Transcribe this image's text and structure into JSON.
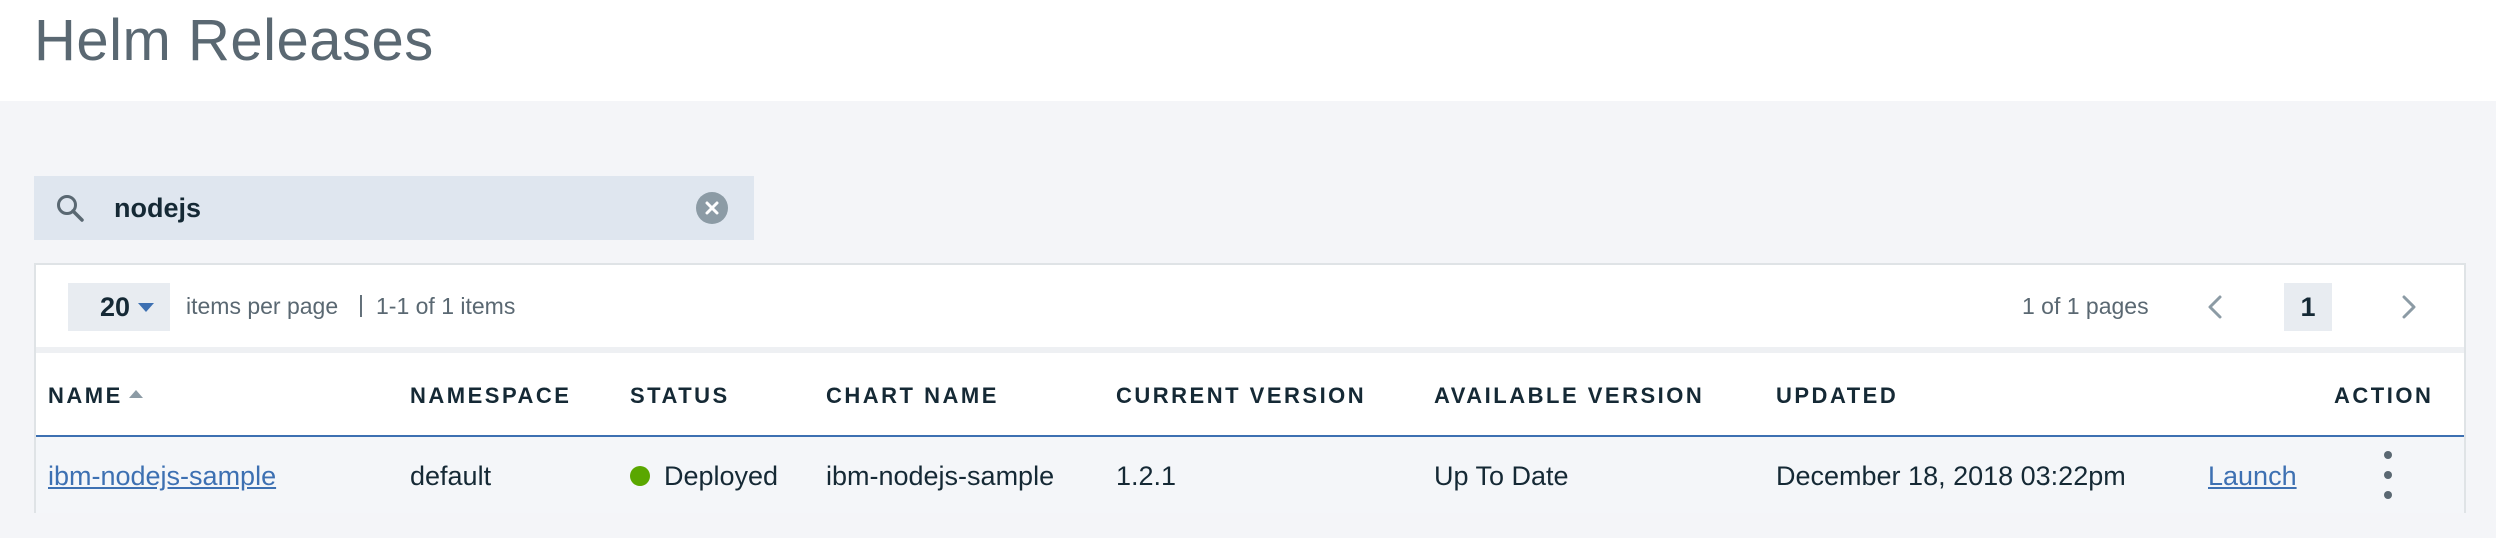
{
  "page": {
    "title": "Helm Releases"
  },
  "search": {
    "value": "nodejs",
    "icon": "search-icon",
    "clear_icon": "close-icon"
  },
  "pagination": {
    "per_page_value": "20",
    "per_page_label": "items per page",
    "separator": "|",
    "range_label": "1-1 of 1 items",
    "pages_label": "1 of 1 pages",
    "current_page": "1"
  },
  "table": {
    "columns": [
      "NAME",
      "NAMESPACE",
      "STATUS",
      "CHART NAME",
      "CURRENT VERSION",
      "AVAILABLE VERSION",
      "UPDATED",
      "ACTION"
    ],
    "sort_column": "NAME",
    "rows": [
      {
        "name": "ibm-nodejs-sample",
        "namespace": "default",
        "status": "Deployed",
        "status_color": "#5aa700",
        "chart_name": "ibm-nodejs-sample",
        "current_version": "1.2.1",
        "available_version": "Up To Date",
        "updated": "December 18, 2018 03:22pm",
        "launch": "Launch"
      }
    ]
  },
  "colors": {
    "accent": "#3d70b2",
    "status_ok": "#5aa700"
  }
}
